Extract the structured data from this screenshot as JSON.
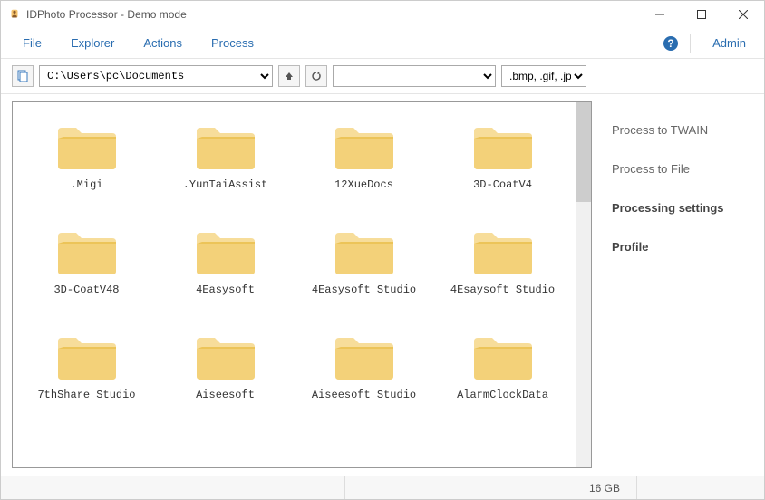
{
  "window": {
    "title": "IDPhoto Processor - Demo mode"
  },
  "menu": {
    "file": "File",
    "explorer": "Explorer",
    "actions": "Actions",
    "process": "Process",
    "admin": "Admin"
  },
  "toolbar": {
    "path": "C:\\Users\\pc\\Documents",
    "filter": ".bmp, .gif, .jpg"
  },
  "folders": [
    {
      "name": ".Migi"
    },
    {
      "name": ".YunTaiAssist"
    },
    {
      "name": "12XueDocs"
    },
    {
      "name": "3D-CoatV4"
    },
    {
      "name": "3D-CoatV48"
    },
    {
      "name": "4Easysoft"
    },
    {
      "name": "4Easysoft Studio"
    },
    {
      "name": "4Esaysoft Studio"
    },
    {
      "name": "7thShare Studio"
    },
    {
      "name": "Aiseesoft"
    },
    {
      "name": "Aiseesoft Studio"
    },
    {
      "name": "AlarmClockData"
    }
  ],
  "sidebar": {
    "twain": "Process to TWAIN",
    "file": "Process to File",
    "settings": "Processing settings",
    "profile": "Profile"
  },
  "status": {
    "disk": "16 GB"
  }
}
